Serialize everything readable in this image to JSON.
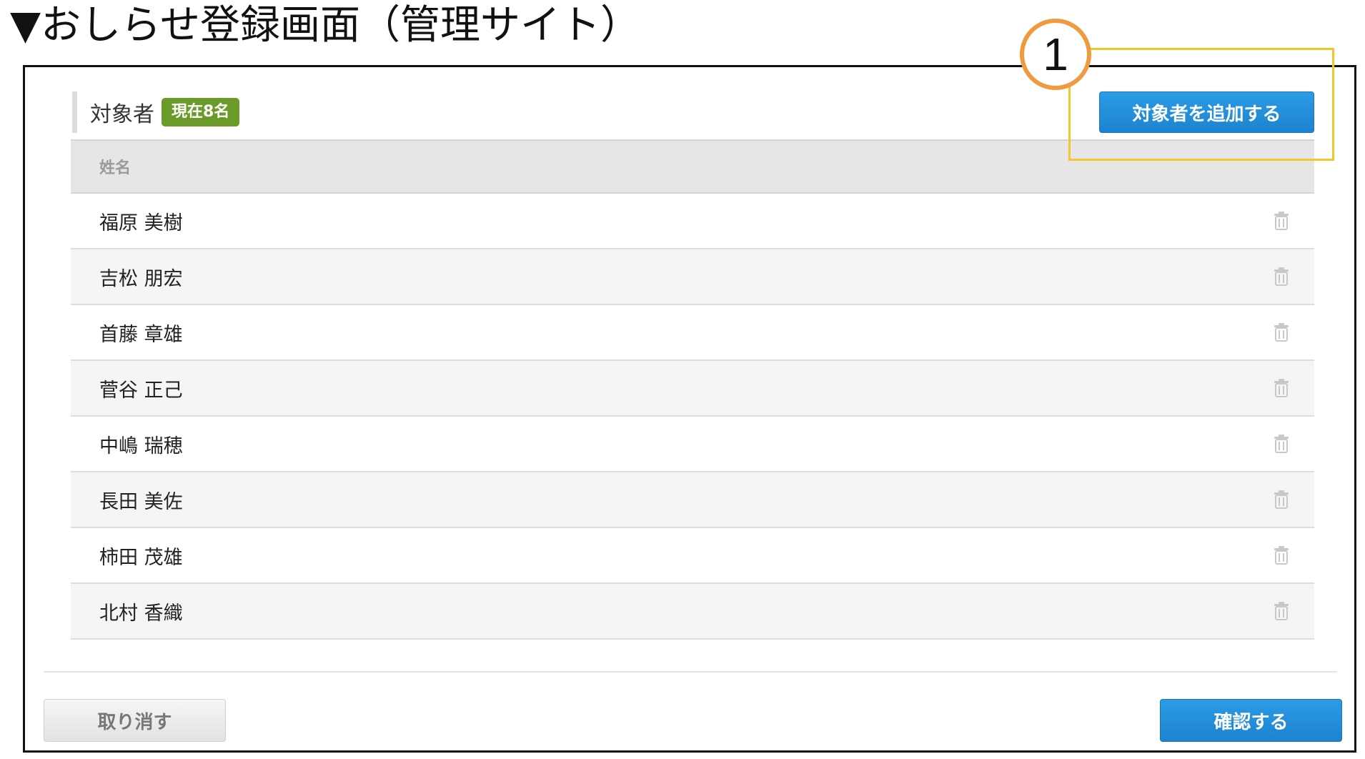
{
  "page_heading": "▼おしらせ登録画面（管理サイト）",
  "annotation": {
    "step_number": "1"
  },
  "section": {
    "title": "対象者",
    "count_badge": "現在8名",
    "add_button_label": "対象者を追加する"
  },
  "table": {
    "header": "姓名",
    "rows": [
      {
        "name": "福原 美樹"
      },
      {
        "name": "吉松 朋宏"
      },
      {
        "name": "首藤 章雄"
      },
      {
        "name": "菅谷 正己"
      },
      {
        "name": "中嶋 瑞穂"
      },
      {
        "name": "長田 美佐"
      },
      {
        "name": "柿田 茂雄"
      },
      {
        "name": "北村 香織"
      }
    ],
    "row_action_icon": "trash-icon"
  },
  "footer": {
    "cancel_label": "取り消す",
    "confirm_label": "確認する"
  },
  "colors": {
    "primary_button": "#1c83cf",
    "badge_green": "#6a9a28",
    "highlight_yellow": "#f3c52f",
    "marker_orange": "#ef9a3e"
  }
}
